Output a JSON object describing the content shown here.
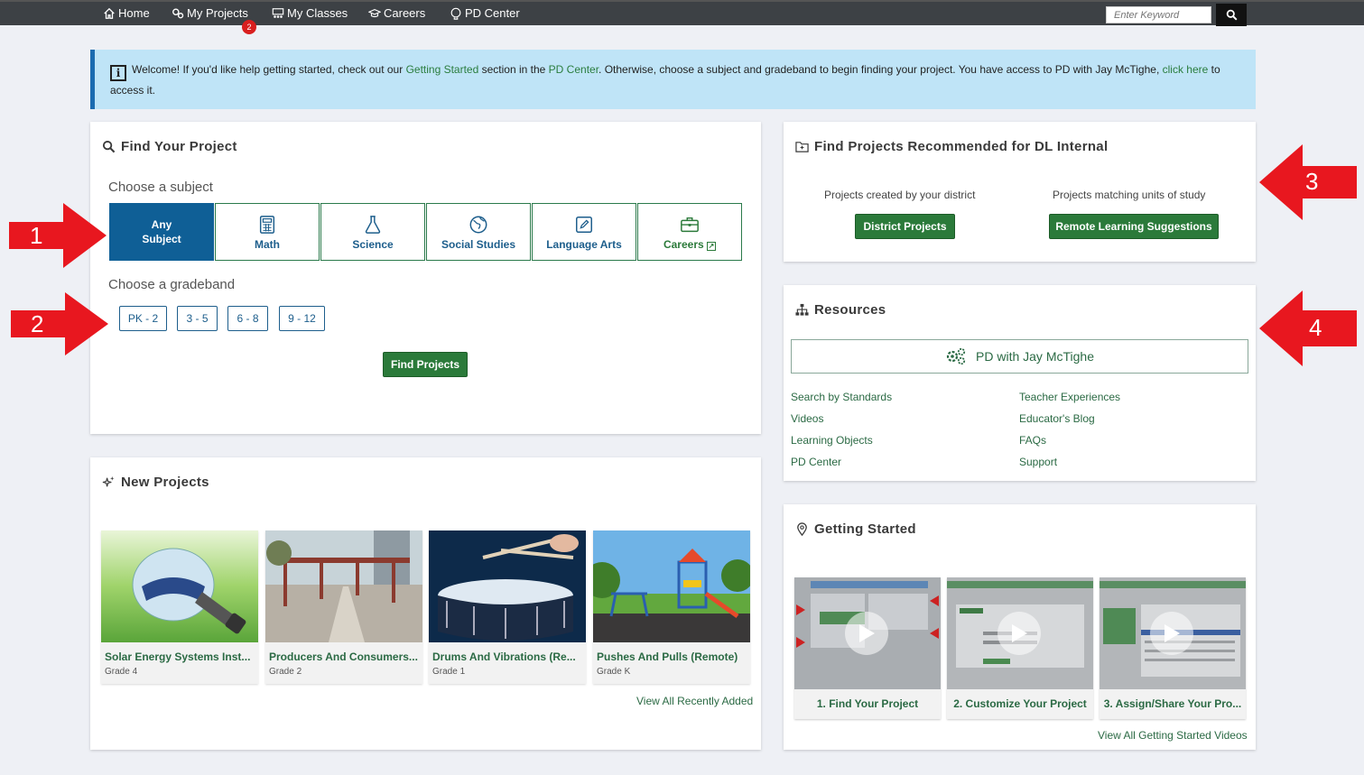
{
  "nav": {
    "items": [
      {
        "label": "Home",
        "icon": "home-icon"
      },
      {
        "label": "My Projects",
        "icon": "gears-icon"
      },
      {
        "label": "My Classes",
        "icon": "classroom-icon"
      },
      {
        "label": "Careers",
        "icon": "graduation-cap-icon"
      },
      {
        "label": "PD Center",
        "icon": "pd-icon"
      }
    ],
    "projects_badge": "2",
    "search_placeholder": "Enter Keyword"
  },
  "alert": {
    "text_1": "Welcome! If you'd like help getting started, check out our ",
    "link_1": "Getting Started",
    "text_2": " section in the ",
    "link_2": "PD Center",
    "text_3": ". Otherwise, choose a subject and gradeband to begin finding your project. You have access to PD with Jay McTighe, ",
    "link_3": "click here",
    "text_4": " to access it."
  },
  "find": {
    "title": "Find Your Project",
    "subject_label": "Choose a subject",
    "subjects": [
      "Any Subject",
      "Math",
      "Science",
      "Social Studies",
      "Language Arts",
      "Careers"
    ],
    "gradeband_label": "Choose a gradeband",
    "gradebands": [
      "PK - 2",
      "3 - 5",
      "6 - 8",
      "9 - 12"
    ],
    "find_button": "Find Projects"
  },
  "recommended": {
    "title": "Find Projects Recommended for DL Internal",
    "district_label": "Projects created by your district",
    "district_button": "District Projects",
    "units_label": "Projects matching units of study",
    "units_button": "Remote Learning Suggestions"
  },
  "resources": {
    "title": "Resources",
    "pd_label": "PD with Jay McTighe",
    "links_left": [
      "Search by Standards",
      "Videos",
      "Learning Objects",
      "PD Center"
    ],
    "links_right": [
      "Teacher Experiences",
      "Educator's Blog",
      "FAQs",
      "Support"
    ]
  },
  "new_projects": {
    "title": "New Projects",
    "items": [
      {
        "title": "Solar Energy Systems Inst...",
        "grade": "Grade 4"
      },
      {
        "title": "Producers And Consumers...",
        "grade": "Grade 2"
      },
      {
        "title": "Drums And Vibrations (Re...",
        "grade": "Grade 1"
      },
      {
        "title": "Pushes And Pulls (Remote)",
        "grade": "Grade K"
      }
    ],
    "view_all": "View All Recently Added"
  },
  "getting_started": {
    "title": "Getting Started",
    "videos": [
      "1. Find Your Project",
      "2. Customize Your Project",
      "3. Assign/Share Your Pro..."
    ],
    "view_all": "View All Getting Started Videos"
  },
  "annotations": [
    "1",
    "2",
    "3",
    "4"
  ],
  "colors": {
    "accent_green": "#2b7a3a",
    "accent_blue": "#0f5f96",
    "annotation_red": "#e8171f"
  }
}
